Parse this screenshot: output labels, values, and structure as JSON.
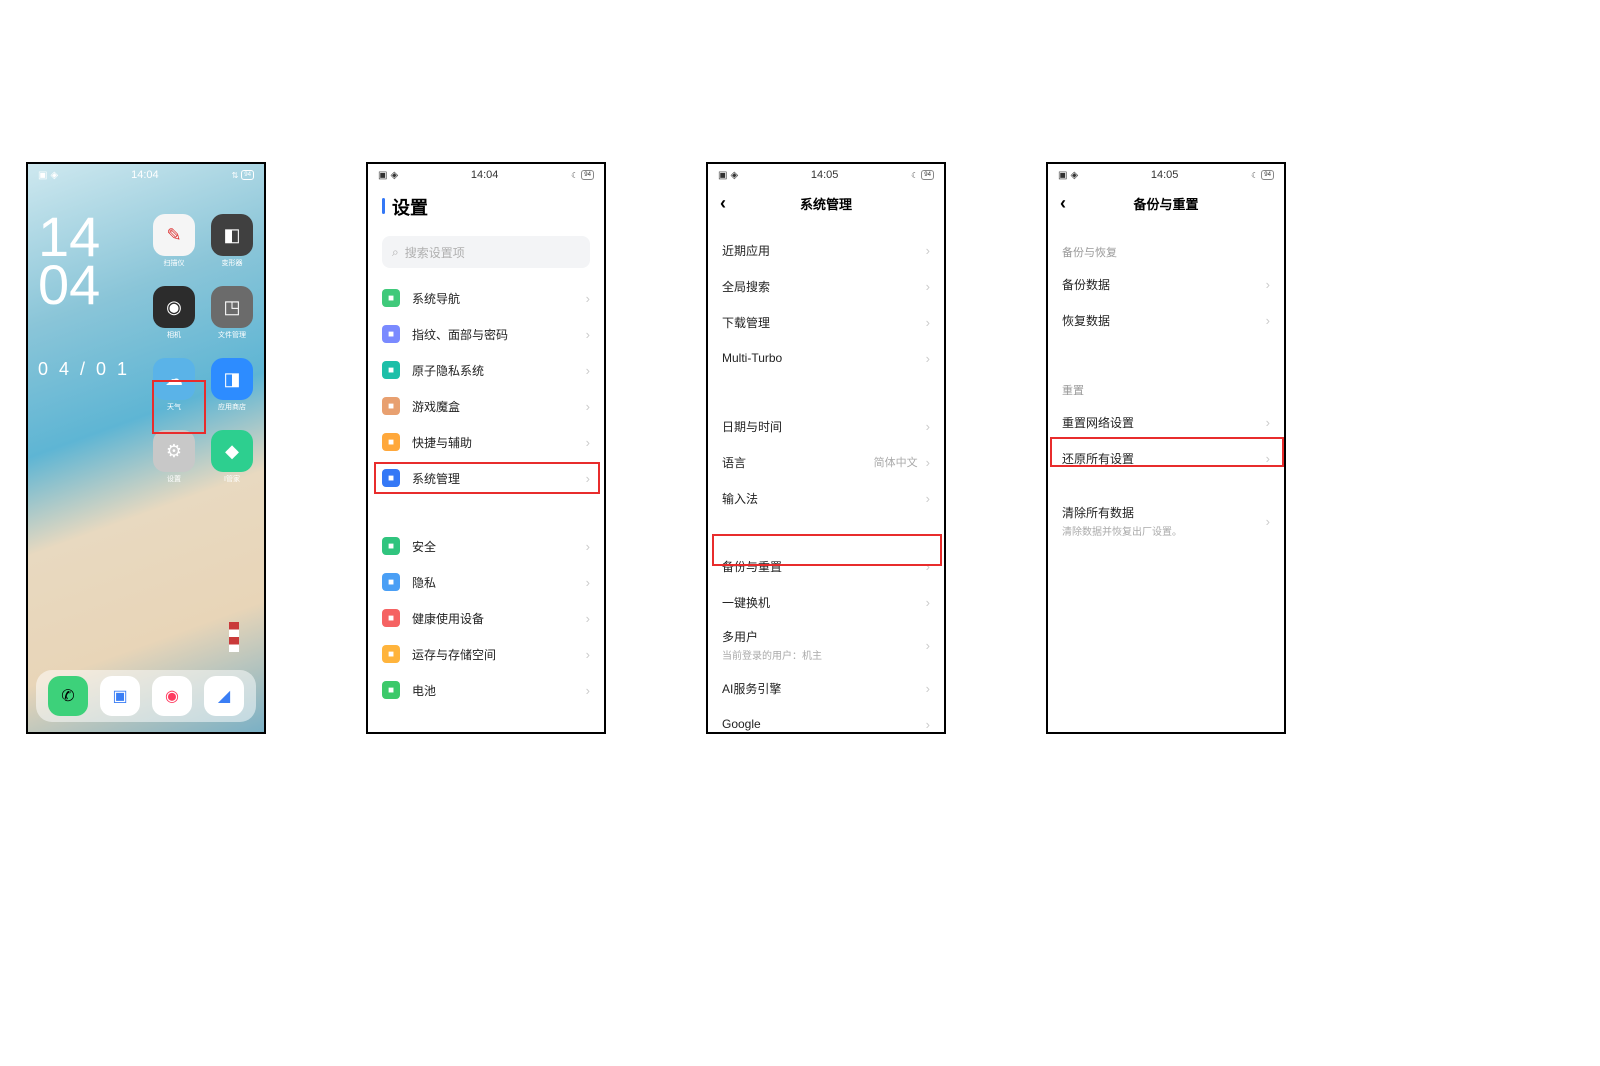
{
  "phone1": {
    "status_time": "14:04",
    "battery": "94",
    "hour": "14",
    "minute": "04",
    "date": "0 4  /  0 1",
    "apps": [
      {
        "label": "扫描仪",
        "bg": "#f5f5f5"
      },
      {
        "label": "变形器",
        "bg": "#404040"
      },
      {
        "label": "相机",
        "bg": "#2c2c2c"
      },
      {
        "label": "文件管理",
        "bg": "#6b6b6b"
      },
      {
        "label": "天气",
        "bg": "#5ab3e8"
      },
      {
        "label": "应用商店",
        "bg": "#2d8cff"
      },
      {
        "label": "设置",
        "bg": "#c8c8c8"
      },
      {
        "label": "I管家",
        "bg": "#2dcf8f"
      }
    ]
  },
  "phone2": {
    "status_time": "14:04",
    "battery": "94",
    "title": "设置",
    "search_placeholder": "搜索设置项",
    "rows": [
      {
        "label": "系统导航",
        "icon_bg": "#3fc97a"
      },
      {
        "label": "指纹、面部与密码",
        "icon_bg": "#7a8aff"
      },
      {
        "label": "原子隐私系统",
        "icon_bg": "#1dbfa8"
      },
      {
        "label": "游戏魔盒",
        "icon_bg": "#e8a070"
      },
      {
        "label": "快捷与辅助",
        "icon_bg": "#ffa83b"
      },
      {
        "label": "系统管理",
        "icon_bg": "#3478f6"
      }
    ],
    "rows2": [
      {
        "label": "安全",
        "icon_bg": "#30c47e"
      },
      {
        "label": "隐私",
        "icon_bg": "#4a9ff5"
      },
      {
        "label": "健康使用设备",
        "icon_bg": "#f56262"
      },
      {
        "label": "运存与存储空间",
        "icon_bg": "#ffb43c"
      },
      {
        "label": "电池",
        "icon_bg": "#3cc96a"
      }
    ]
  },
  "phone3": {
    "status_time": "14:05",
    "battery": "94",
    "title": "系统管理",
    "rows": [
      {
        "label": "近期应用"
      },
      {
        "label": "全局搜索"
      },
      {
        "label": "下载管理"
      },
      {
        "label": "Multi-Turbo"
      }
    ],
    "rows2": [
      {
        "label": "日期与时间"
      },
      {
        "label": "语言",
        "value": "简体中文"
      },
      {
        "label": "输入法"
      }
    ],
    "rows3": [
      {
        "label": "备份与重置"
      },
      {
        "label": "一键换机"
      },
      {
        "label": "多用户",
        "sub": "当前登录的用户：机主"
      },
      {
        "label": "AI服务引擎"
      },
      {
        "label": "Google"
      }
    ]
  },
  "phone4": {
    "status_time": "14:05",
    "battery": "94",
    "title": "备份与重置",
    "section1": "备份与恢复",
    "rows1": [
      {
        "label": "备份数据"
      },
      {
        "label": "恢复数据"
      }
    ],
    "section2": "重置",
    "rows2": [
      {
        "label": "重置网络设置"
      },
      {
        "label": "还原所有设置"
      }
    ],
    "rows3": [
      {
        "label": "清除所有数据",
        "sub": "清除数据并恢复出厂设置。"
      }
    ]
  }
}
